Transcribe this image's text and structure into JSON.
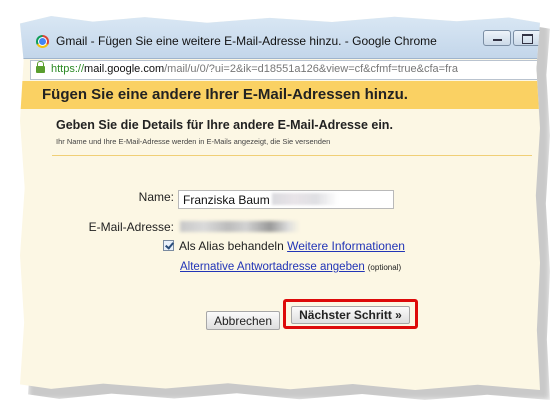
{
  "window": {
    "title": "Gmail - Fügen Sie eine weitere E-Mail-Adresse hinzu. - Google Chrome"
  },
  "address_bar": {
    "scheme": "https://",
    "host": "mail.google.com",
    "path": "/mail/u/0/?ui=2&ik=d18551a126&view=cf&cfmf=true&cfa=fra"
  },
  "dialog": {
    "heading": "Fügen Sie eine andere Ihrer E-Mail-Adressen hinzu.",
    "subheading": "Geben Sie die Details für Ihre andere E-Mail-Adresse ein.",
    "subtext": "Ihr Name und Ihre E-Mail-Adresse werden in E-Mails angezeigt, die Sie versenden",
    "name_label": "Name:",
    "name_value": "Franziska Baum",
    "email_label": "E-Mail-Adresse:",
    "alias_checked": true,
    "alias_label": "Als Alias behandeln",
    "more_info_link": "Weitere Informationen",
    "alt_reply_link": "Alternative Antwortadresse angeben",
    "optional_text": "(optional)",
    "cancel_button": "Abbrechen",
    "next_button": "Nächster Schritt »"
  },
  "colors": {
    "heading_band": "#fad163",
    "panel": "#fcf7e4",
    "link": "#2235b7",
    "highlight": "#dd0a0a"
  }
}
